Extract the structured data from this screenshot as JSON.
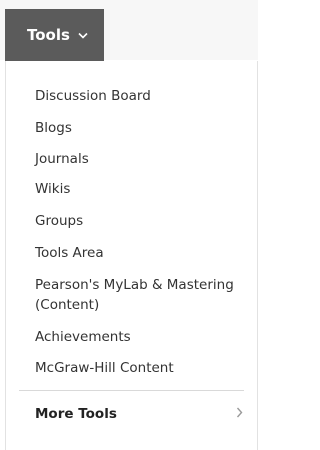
{
  "header": {
    "tools_label": "Tools",
    "tools_icon": "chevron-down-icon"
  },
  "menu": {
    "items": [
      "Discussion Board",
      "Blogs",
      "Journals",
      "Wikis",
      "Groups",
      "Tools Area",
      "Pearson's MyLab & Mastering (Content)",
      "Achievements",
      "McGraw-Hill Content"
    ],
    "more_tools_label": "More Tools",
    "more_tools_icon": "chevron-right-icon"
  },
  "colors": {
    "button_bg": "#5b5b5b",
    "text": "#333333"
  }
}
